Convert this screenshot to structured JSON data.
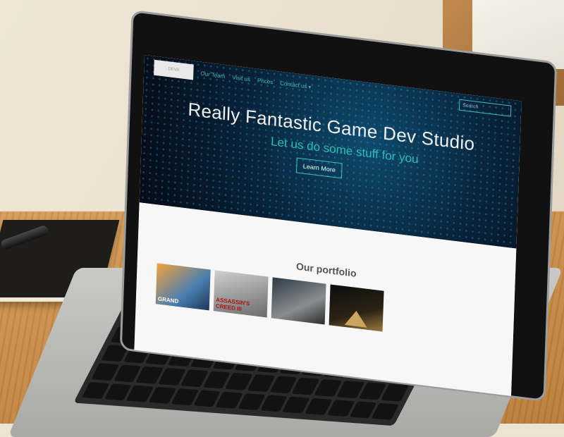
{
  "nav": {
    "logo_text": "DEVA",
    "links": [
      "Our Team",
      "Visit us",
      "Prices",
      "Contact us"
    ],
    "contact_caret": "▾",
    "search_placeholder": "Search"
  },
  "hero": {
    "title": "Really Fantastic Game Dev Studio",
    "subtitle": "Let us do some stuff for you",
    "button_label": "Learn More"
  },
  "portfolio": {
    "title": "Our portfolio",
    "items": [
      {
        "label": "GRAND"
      },
      {
        "label": "ASSASSIN'S CREED III"
      },
      {
        "label": ""
      },
      {
        "label": ""
      }
    ]
  },
  "colors": {
    "accent": "#3cc2bf",
    "hero_bg": "#082036",
    "page_bg": "#f7f7f7"
  }
}
